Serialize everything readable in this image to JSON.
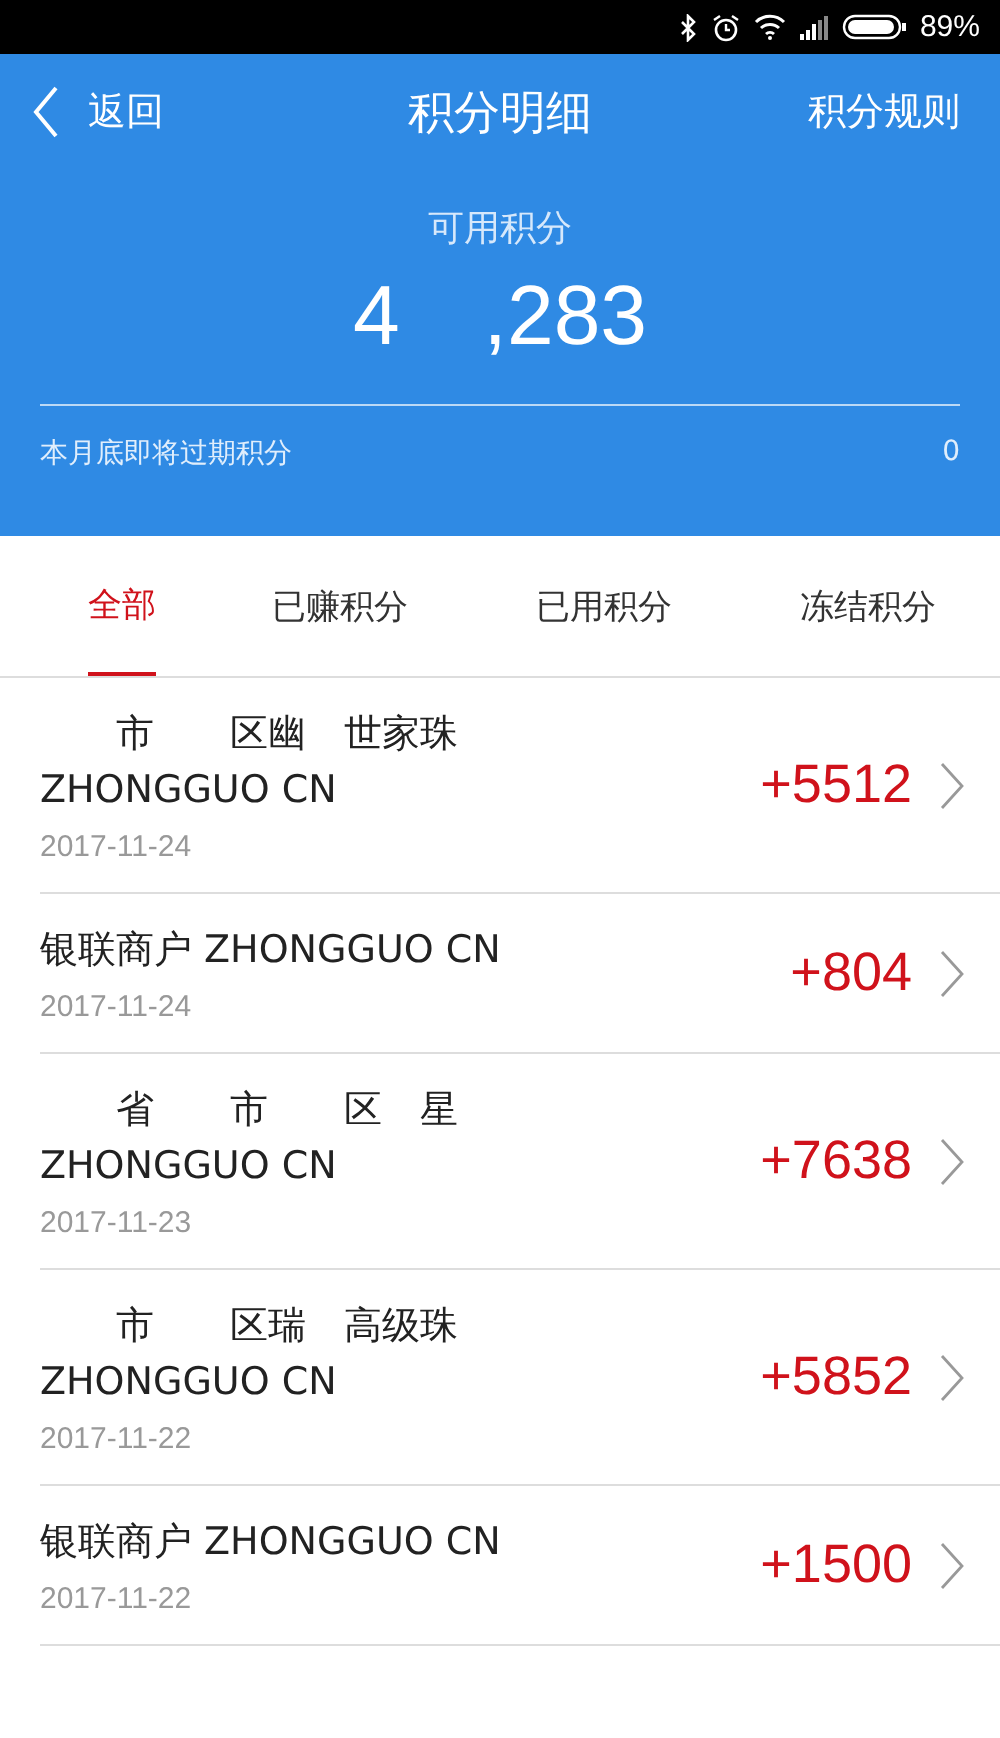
{
  "status_bar": {
    "battery": "89%"
  },
  "nav": {
    "back": "返回",
    "title": "积分明细",
    "action": "积分规则"
  },
  "summary": {
    "label": "可用积分",
    "balance": "4　,283",
    "expiring_label": "本月底即将过期积分",
    "expiring_value": "0"
  },
  "tabs": [
    {
      "label": "全部",
      "selected": true
    },
    {
      "label": "已赚积分",
      "selected": false
    },
    {
      "label": "已用积分",
      "selected": false
    },
    {
      "label": "冻结积分",
      "selected": false
    }
  ],
  "records": [
    {
      "lines": [
        "　　市　　区幽　世家珠",
        "ZHONGGUO CN"
      ],
      "date": "2017-11-24",
      "points": "+5512"
    },
    {
      "lines": [
        "银联商户 ZHONGGUO CN"
      ],
      "date": "2017-11-24",
      "points": "+804"
    },
    {
      "lines": [
        "　　省　　市　　区　星",
        "ZHONGGUO CN"
      ],
      "date": "2017-11-23",
      "points": "+7638"
    },
    {
      "lines": [
        "　　市　　区瑞　高级珠",
        "ZHONGGUO CN"
      ],
      "date": "2017-11-22",
      "points": "+5852"
    },
    {
      "lines": [
        "银联商户 ZHONGGUO CN"
      ],
      "date": "2017-11-22",
      "points": "+1500"
    }
  ]
}
